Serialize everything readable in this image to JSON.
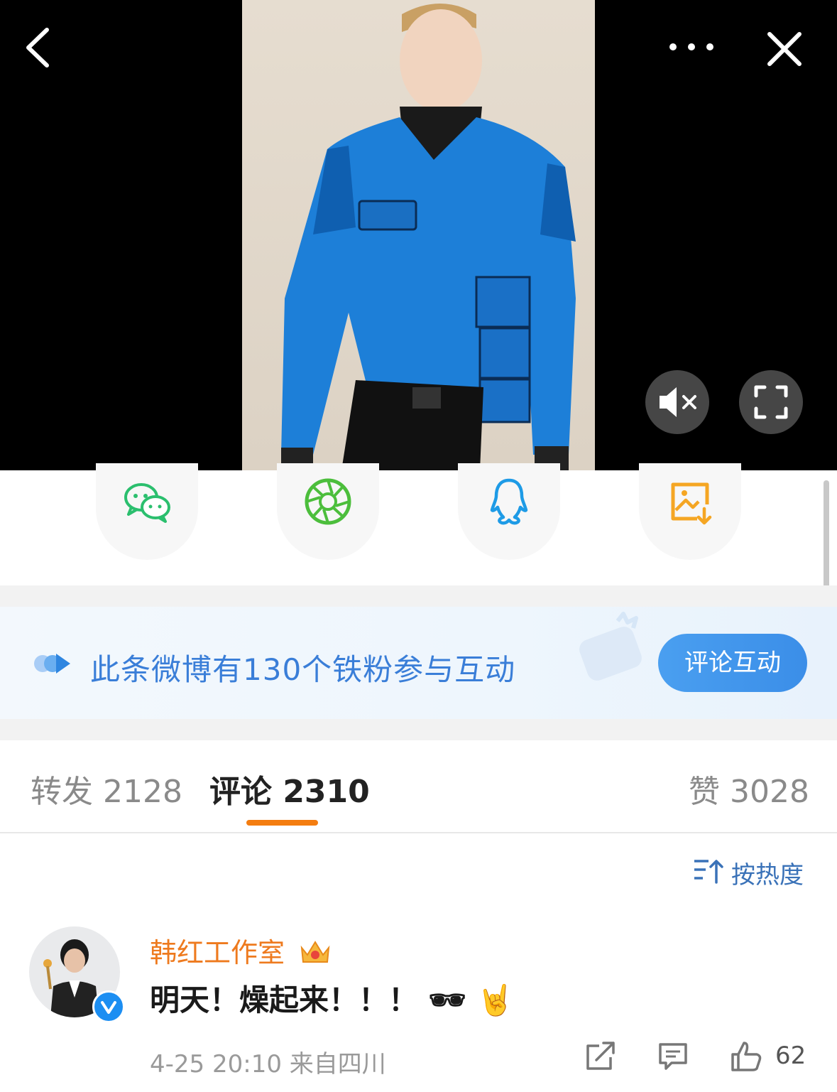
{
  "fan_banner": {
    "text": "此条微博有130个铁粉参与互动",
    "button_label": "评论互动"
  },
  "tabs": [
    {
      "label": "转发 2128"
    },
    {
      "label": "评论 2310"
    },
    {
      "label": "赞 3028"
    }
  ],
  "sort": {
    "label": "按热度"
  },
  "comment": {
    "username": "韩红工作室",
    "text": "明天！燥起来！！！ 🕶 🤘",
    "meta": "4-25 20:10 来自四川",
    "like_count": "62"
  },
  "colors": {
    "accent_orange": "#f47d10",
    "link_blue": "#3a7ed8",
    "username_orange": "#ee7a1e"
  }
}
